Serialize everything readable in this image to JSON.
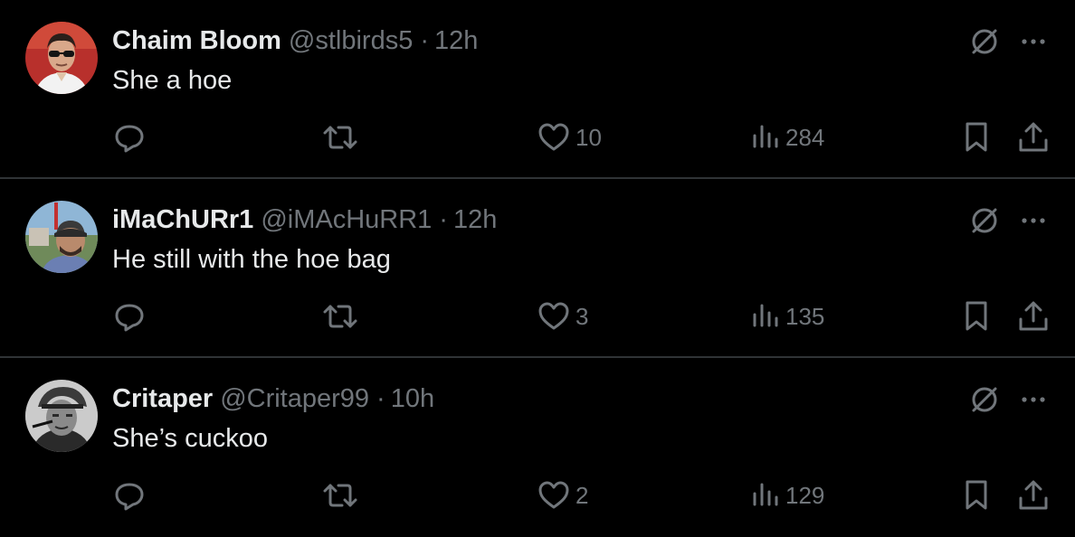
{
  "colors": {
    "background": "#000000",
    "primary_text": "#e7e9ea",
    "secondary_text": "#71767b",
    "divider": "#2f3336"
  },
  "icons": {
    "reply": "reply-icon",
    "retweet": "retweet-icon",
    "like": "heart-icon",
    "views": "views-icon",
    "bookmark": "bookmark-icon",
    "share": "share-icon",
    "grok": "grok-icon",
    "more": "more-icon"
  },
  "tweets": [
    {
      "display_name": "Chaim Bloom",
      "handle": "@stlbirds5",
      "separator": "·",
      "time": "12h",
      "text": "She a hoe",
      "likes": "10",
      "views": "284"
    },
    {
      "display_name": "iMaChURr1",
      "handle": "@iMAcHuRR1",
      "separator": "·",
      "time": "12h",
      "text": "He still with the hoe bag",
      "likes": "3",
      "views": "135"
    },
    {
      "display_name": "Critaper",
      "handle": "@Critaper99",
      "separator": "·",
      "time": "10h",
      "text": "She’s cuckoo",
      "likes": "2",
      "views": "129"
    }
  ]
}
